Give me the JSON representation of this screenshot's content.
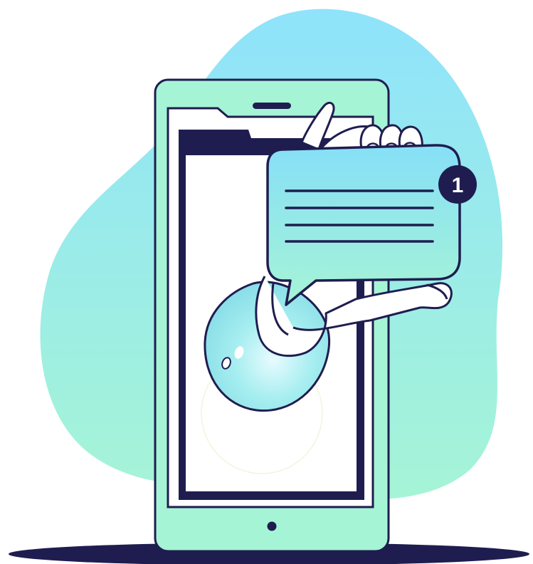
{
  "illustration": {
    "notification": {
      "badge_count": "1",
      "text_lines": 4
    },
    "colors": {
      "outline": "#1f1d4f",
      "phone_body": "#a6f4d6",
      "blob_top": "#8fe3fb",
      "blob_bottom": "#a6f4d6",
      "bubble_top": "#86dff7",
      "bubble_bottom": "#a6f4d6",
      "sleeve": "#8ee0e6",
      "screen": "#ffffff",
      "skin": "#ffffff"
    },
    "icons": [
      "speech-bubble-icon",
      "notification-badge-icon",
      "hand-icon",
      "smartphone-icon"
    ]
  }
}
